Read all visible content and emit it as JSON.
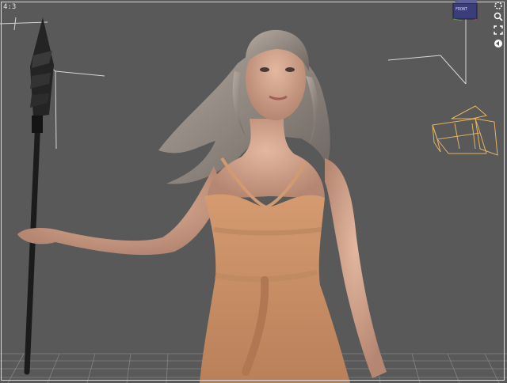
{
  "viewport": {
    "aspect_label": "4:3",
    "background_color": "#595959",
    "frame_color": "#d8d8d8",
    "cube_label": "FRONT"
  },
  "controls": [
    {
      "name": "orbit-icon"
    },
    {
      "name": "zoom-icon"
    },
    {
      "name": "frame-icon"
    },
    {
      "name": "pan-icon"
    }
  ],
  "scene": {
    "character": "woman-in-orange-dress",
    "prop": "spear",
    "helpers": [
      "camera-gizmo",
      "light-guide-lines",
      "floor-grid"
    ]
  }
}
